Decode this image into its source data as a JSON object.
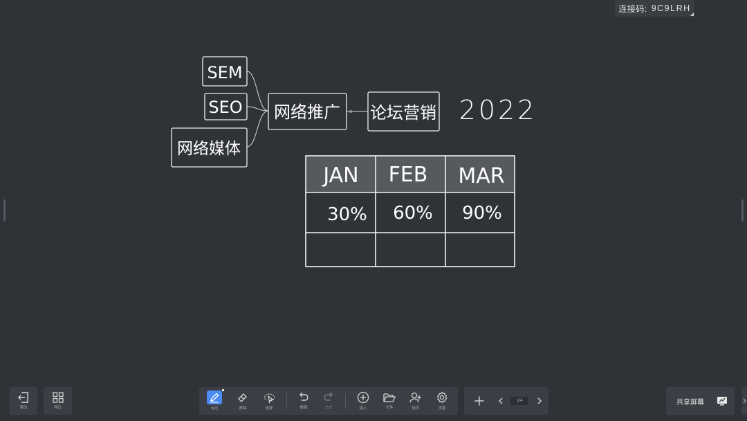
{
  "connection": {
    "label": "连接码:",
    "code": "9C9LRH"
  },
  "mindmap": {
    "nodes": [
      "SEM",
      "SEO",
      "网络媒体",
      "网络推广",
      "论坛营销"
    ],
    "year": "2022"
  },
  "table": {
    "headers": [
      "JAN",
      "FEB",
      "MAR"
    ],
    "rows": [
      [
        "30%",
        "60%",
        "90%"
      ],
      [
        "",
        "",
        ""
      ]
    ]
  },
  "toolbar_left": {
    "back_label": "退出",
    "overview_label": "导出"
  },
  "toolbar_main": {
    "write_label": "书写",
    "eraser_label": "擦除",
    "select_label": "选择",
    "undo_label": "撤销",
    "redo_label": "重做",
    "insert_label": "插入",
    "file_label": "文件",
    "collab_label": "协同",
    "settings_label": "设置"
  },
  "pager": {
    "page": "1/4"
  },
  "share": {
    "label": "共享屏幕"
  },
  "colors": {
    "background": "#2f3237",
    "toolbar": "#3b3e44",
    "accent": "#4b8cf5"
  }
}
